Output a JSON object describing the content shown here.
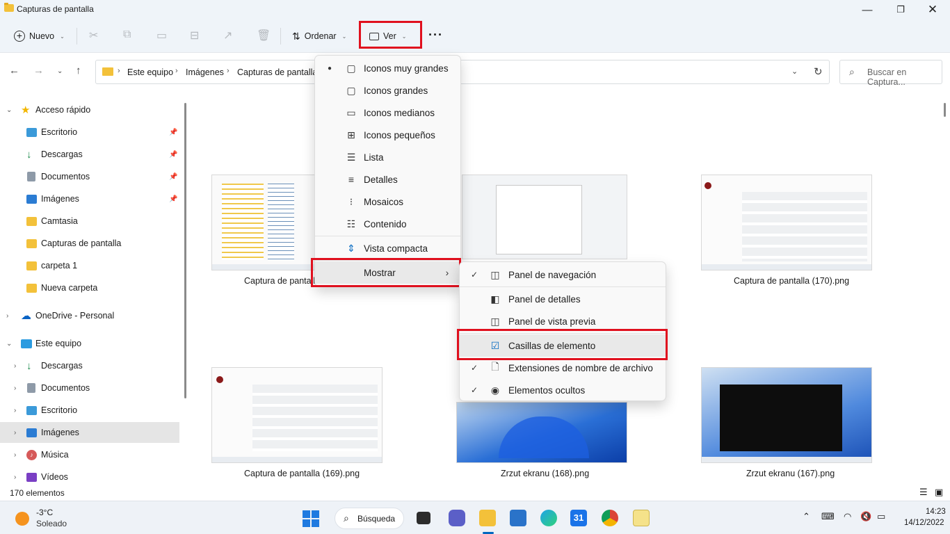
{
  "window": {
    "title": "Capturas de pantalla"
  },
  "toolbar": {
    "new_label": "Nuevo",
    "sort_label": "Ordenar",
    "view_label": "Ver",
    "more_label": "···"
  },
  "address": {
    "crumbs": [
      "Este equipo",
      "Imágenes",
      "Capturas de pantalla"
    ],
    "search_placeholder": "Buscar en Captura..."
  },
  "sidebar": {
    "quick_access": "Acceso rápido",
    "quick_items": [
      "Escritorio",
      "Descargas",
      "Documentos",
      "Imágenes",
      "Camtasia",
      "Capturas de pantalla",
      "carpeta 1",
      "Nueva carpeta"
    ],
    "onedrive": "OneDrive - Personal",
    "this_pc": "Este equipo",
    "pc_items": [
      "Descargas",
      "Documentos",
      "Escritorio",
      "Imágenes",
      "Música",
      "Vídeos"
    ]
  },
  "files": [
    "Captura de pantalla",
    "Captura de pantalla (170).png",
    "Captura de pantalla (169).png",
    "Zrzut ekranu (168).png",
    "Zrzut ekranu (167).png"
  ],
  "status": {
    "count": "170 elementos"
  },
  "view_menu": {
    "items": [
      "Iconos muy grandes",
      "Iconos grandes",
      "Iconos medianos",
      "Iconos pequeños",
      "Lista",
      "Detalles",
      "Mosaicos",
      "Contenido",
      "Vista compacta",
      "Mostrar"
    ]
  },
  "show_menu": {
    "items": [
      "Panel de navegación",
      "Panel de detalles",
      "Panel de vista previa",
      "Casillas de elemento",
      "Extensiones de nombre de archivo",
      "Elementos ocultos"
    ]
  },
  "taskbar": {
    "weather_temp": "-3°C",
    "weather_desc": "Soleado",
    "search_label": "Búsqueda",
    "calendar_day": "31",
    "time": "14:23",
    "date": "14/12/2022"
  },
  "colors": {
    "highlight_red": "#e0101e",
    "accent_blue": "#0067c0",
    "folder_yellow": "#f3c13a"
  }
}
